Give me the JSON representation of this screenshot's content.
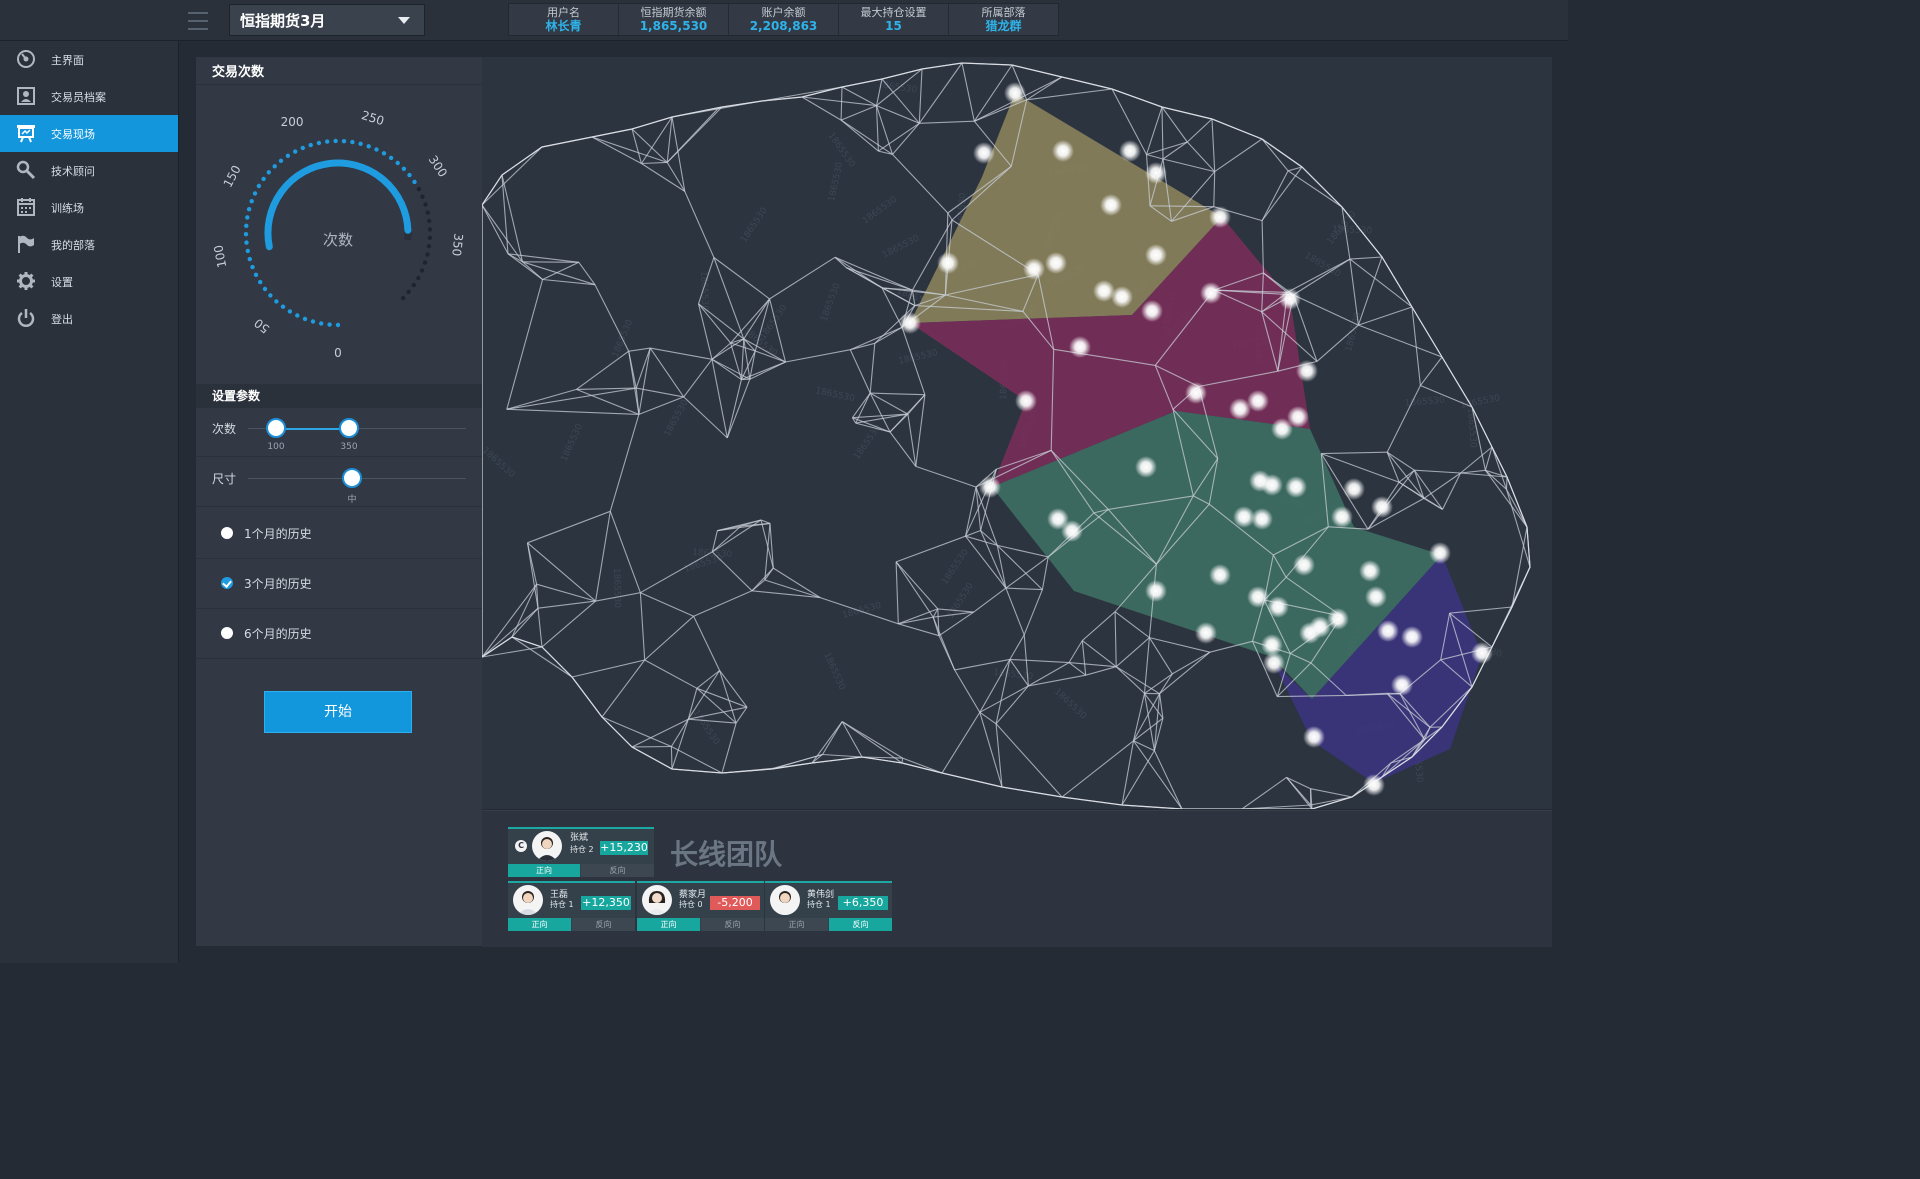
{
  "header": {
    "contract": "恒指期货3月",
    "info": [
      {
        "label": "用户名",
        "value": "林长青"
      },
      {
        "label": "恒指期货余额",
        "value": "1,865,530"
      },
      {
        "label": "账户余额",
        "value": "2,208,863"
      },
      {
        "label": "最大持仓设置",
        "value": "15"
      },
      {
        "label": "所属部落",
        "value": "猎龙群"
      }
    ]
  },
  "sidebar": {
    "items": [
      {
        "label": "主界面",
        "icon": "dashboard-icon"
      },
      {
        "label": "交易员档案",
        "icon": "profile-icon"
      },
      {
        "label": "交易现场",
        "icon": "presentation-icon"
      },
      {
        "label": "技术顾问",
        "icon": "search-key-icon"
      },
      {
        "label": "训练场",
        "icon": "calendar-icon"
      },
      {
        "label": "我的部落",
        "icon": "flag-icon"
      },
      {
        "label": "设置",
        "icon": "gear-icon"
      },
      {
        "label": "登出",
        "icon": "power-icon"
      }
    ],
    "active_index": 2
  },
  "gauge": {
    "title": "交易次数",
    "center_label": "次数",
    "ticks": [
      "0",
      "50",
      "100",
      "150",
      "200",
      "250",
      "300",
      "350"
    ],
    "min": 0,
    "max": 400,
    "range_low": 100,
    "range_high": 350,
    "accent": "#1f9be0"
  },
  "params": {
    "title": "设置参数",
    "count_label": "次数",
    "count_low": "100",
    "count_high": "350",
    "count_low_fraction": 0.1,
    "count_high_fraction": 0.5,
    "size_label": "尺寸",
    "size_value": "中",
    "size_fraction": 0.5
  },
  "history_options": [
    {
      "label": "1个月的历史",
      "checked": false
    },
    {
      "label": "3个月的历史",
      "checked": true
    },
    {
      "label": "6个月的历史",
      "checked": false
    }
  ],
  "start_button": "开始",
  "map": {
    "watermark": "1865530",
    "regions": [
      {
        "name": "region-olive",
        "color": "#8f875e"
      },
      {
        "name": "region-magenta",
        "color": "#7c2e5a"
      },
      {
        "name": "region-teal",
        "color": "#3e7265"
      },
      {
        "name": "region-indigo",
        "color": "#3c3582"
      }
    ]
  },
  "team": {
    "name": "长线团队",
    "captain": {
      "badge": "C",
      "name": "张斌",
      "position": "持仓 2",
      "pnl": "+15,230",
      "dir_long": "正向",
      "dir_short": "反向",
      "active": "long"
    },
    "members": [
      {
        "name": "王磊",
        "position": "持仓 1",
        "pnl": "+12,350",
        "dir_long": "正向",
        "dir_short": "反向",
        "active": "long"
      },
      {
        "name": "蔡家月",
        "position": "持仓 0",
        "pnl": "-5,200",
        "dir_long": "正向",
        "dir_short": "反向",
        "active": "long"
      },
      {
        "name": "黄伟剑",
        "position": "持仓 1",
        "pnl": "+6,350",
        "dir_long": "正向",
        "dir_short": "反向",
        "active": "short"
      }
    ]
  }
}
